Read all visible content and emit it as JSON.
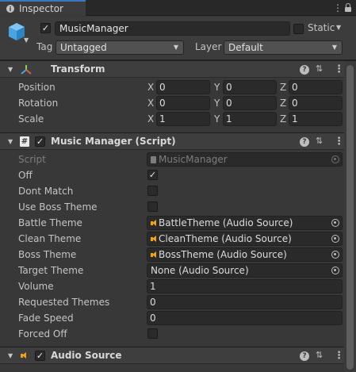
{
  "tab": {
    "label": "Inspector",
    "info_icon": "info-icon",
    "menu": "⋮",
    "lock_icon": "lock-icon"
  },
  "gameobject": {
    "icon": "cube-icon",
    "active": true,
    "name": "MusicManager",
    "static_label": "Static",
    "tag_label": "Tag",
    "tag_value": "Untagged",
    "layer_label": "Layer",
    "layer_value": "Default"
  },
  "transform": {
    "title": "Transform",
    "rows": [
      {
        "label": "Position",
        "x": "0",
        "y": "0",
        "z": "0"
      },
      {
        "label": "Rotation",
        "x": "0",
        "y": "0",
        "z": "0"
      },
      {
        "label": "Scale",
        "x": "1",
        "y": "1",
        "z": "1"
      }
    ],
    "axes": {
      "x": "X",
      "y": "Y",
      "z": "Z"
    }
  },
  "script_component": {
    "title": "Music Manager (Script)",
    "enabled": true,
    "fields": {
      "script": {
        "label": "Script",
        "value": "MusicManager"
      },
      "off": {
        "label": "Off",
        "checked": true
      },
      "dont_match": {
        "label": "Dont Match",
        "checked": false
      },
      "use_boss_theme": {
        "label": "Use Boss Theme",
        "checked": false
      },
      "battle_theme": {
        "label": "Battle Theme",
        "value": "BattleTheme (Audio Source)"
      },
      "clean_theme": {
        "label": "Clean Theme",
        "value": "CleanTheme (Audio Source)"
      },
      "boss_theme": {
        "label": "Boss Theme",
        "value": "BossTheme (Audio Source)"
      },
      "target_theme": {
        "label": "Target Theme",
        "value": "None (Audio Source)"
      },
      "volume": {
        "label": "Volume",
        "value": "1"
      },
      "requested_themes": {
        "label": "Requested Themes",
        "value": "0"
      },
      "fade_speed": {
        "label": "Fade Speed",
        "value": "0"
      },
      "forced_off": {
        "label": "Forced Off",
        "checked": false
      }
    }
  },
  "audio_source": {
    "title": "Audio Source",
    "enabled": true
  },
  "colors": {
    "background": "#383838",
    "accent": "#3a79bb",
    "speaker": "#f0a21b"
  }
}
